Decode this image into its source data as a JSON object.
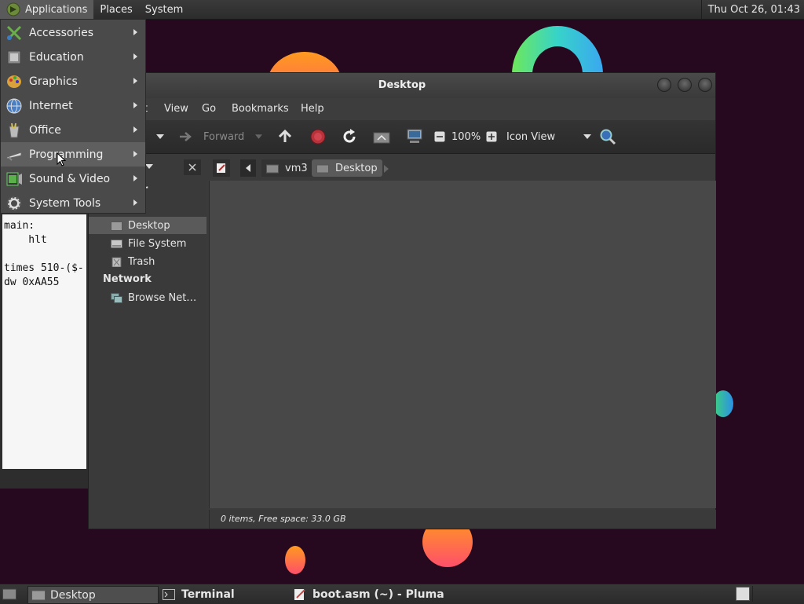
{
  "top_panel": {
    "menus": [
      "Applications",
      "Places",
      "System"
    ],
    "clock": "Thu Oct 26, 01:43"
  },
  "apps_menu": {
    "items": [
      {
        "label": "Accessories",
        "icon": "accessories-icon"
      },
      {
        "label": "Education",
        "icon": "education-icon"
      },
      {
        "label": "Graphics",
        "icon": "graphics-icon"
      },
      {
        "label": "Internet",
        "icon": "internet-globe-icon"
      },
      {
        "label": "Office",
        "icon": "office-icon"
      },
      {
        "label": "Programming",
        "icon": "programming-icon"
      },
      {
        "label": "Sound & Video",
        "icon": "sound-video-icon"
      },
      {
        "label": "System Tools",
        "icon": "system-tools-gear-icon"
      }
    ],
    "hovered": "Programming"
  },
  "pluma": {
    "lines": [
      "main:",
      "    hlt",
      "",
      "times 510-($-",
      "dw 0xAA55"
    ]
  },
  "file_manager": {
    "title": "Desktop",
    "menubar": [
      "t",
      "View",
      "Go",
      "Bookmarks",
      "Help"
    ],
    "toolbar": {
      "forward_label": "Forward",
      "zoom": "100%",
      "view_mode": "Icon View"
    },
    "path": [
      "vm3",
      "Desktop"
    ],
    "sidebar": {
      "partial_labels": [
        "er",
        "3"
      ],
      "places": [
        "Desktop",
        "File System",
        "Trash"
      ],
      "network_header": "Network",
      "network_items": [
        "Browse Net…"
      ]
    },
    "status": "0 items, Free space: 33.0 GB"
  },
  "bottom_panel": {
    "tasks": [
      "Desktop",
      "Terminal",
      "boot.asm (~) - Pluma"
    ]
  },
  "colors": {
    "wallpaper": "#26091f",
    "panel": "#2c2c2c",
    "menu_bg": "#4a4a4a",
    "hover": "#5f5f5f"
  }
}
